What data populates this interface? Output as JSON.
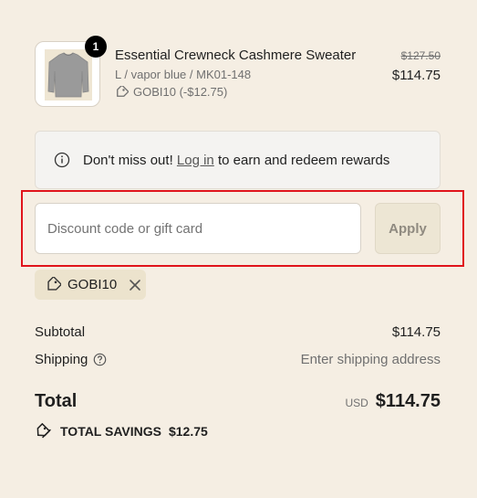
{
  "line_item": {
    "quantity": "1",
    "title": "Essential Crewneck Cashmere Sweater",
    "variant": "L / vapor blue / MK01-148",
    "discount": "GOBI10 (-$12.75)",
    "original_price": "$127.50",
    "price": "$114.75",
    "image_icon": "sweater-image"
  },
  "rewards_banner": {
    "icon": "info-icon",
    "prefix": "Don't miss out!",
    "link": "Log in",
    "suffix": "to earn and redeem rewards"
  },
  "discount_form": {
    "placeholder": "Discount code or gift card",
    "value": "",
    "apply_label": "Apply",
    "highlight_color": "#e0141c"
  },
  "applied_code": {
    "code": "GOBI10",
    "icon": "tag-icon",
    "remove_icon": "close-icon"
  },
  "summary": {
    "subtotal_label": "Subtotal",
    "subtotal_value": "$114.75",
    "shipping_label": "Shipping",
    "shipping_value": "Enter shipping address",
    "total_label": "Total",
    "currency": "USD",
    "total_value": "$114.75",
    "savings_label": "TOTAL SAVINGS",
    "savings_value": "$12.75"
  },
  "colors": {
    "background": "#f5eee3",
    "chip": "#ece3cd",
    "apply_button": "#ede6d4"
  }
}
